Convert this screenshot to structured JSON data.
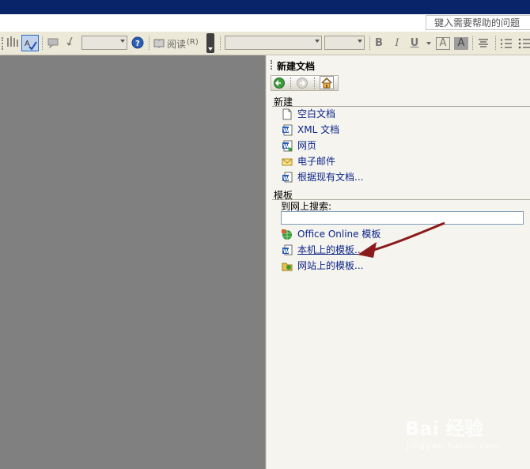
{
  "help_box": {
    "placeholder": "键入需要帮助的问题"
  },
  "toolbar": {
    "read_label": "阅读",
    "read_shortcut": "(R)",
    "bold": "B",
    "italic": "I",
    "underline": "U",
    "font_color_a": "A",
    "highlight_a": "A"
  },
  "task_pane": {
    "title": "新建文档",
    "new_section": {
      "heading": "新建",
      "items": [
        {
          "label": "空白文档",
          "icon": "blank-document-icon"
        },
        {
          "label": "XML 文档",
          "icon": "xml-document-icon"
        },
        {
          "label": "网页",
          "icon": "web-page-icon"
        },
        {
          "label": "电子邮件",
          "icon": "email-icon"
        },
        {
          "label": "根据现有文档...",
          "icon": "existing-document-icon"
        }
      ]
    },
    "templates_section": {
      "heading": "模板",
      "search_label": "到网上搜索:",
      "items": [
        {
          "label": "Office Online 模板",
          "icon": "office-online-icon"
        },
        {
          "label": "本机上的模板...",
          "icon": "local-template-icon"
        },
        {
          "label": "网站上的模板...",
          "icon": "website-template-icon"
        }
      ]
    }
  },
  "annotation": {
    "arrow_color": "#8b1a1a"
  },
  "watermark": {
    "main": "Bai 经验",
    "sub": "jingyan.baidu.com"
  },
  "colors": {
    "titlebar": "#0a246a",
    "doc_area": "#808080",
    "link": "#0b2489"
  }
}
